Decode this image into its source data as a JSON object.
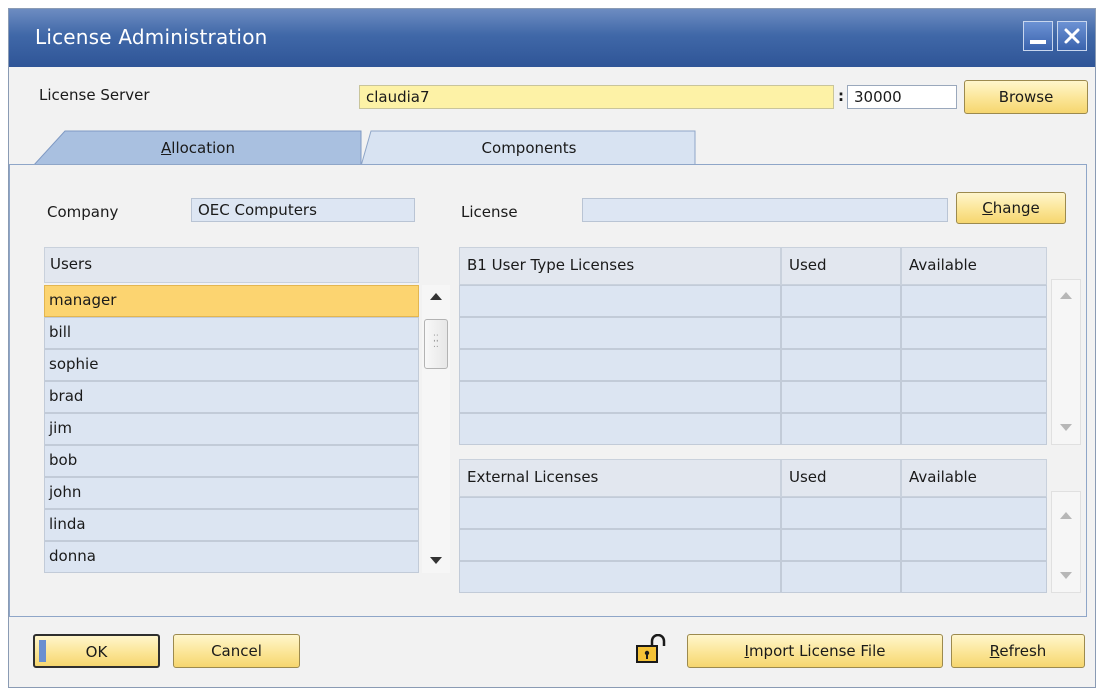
{
  "window": {
    "title": "License Administration"
  },
  "server": {
    "label": "License Server",
    "host": "claudia7",
    "separator": ":",
    "port": "30000",
    "browse_label": "Browse"
  },
  "tabs": [
    {
      "label": "Allocation",
      "active": true
    },
    {
      "label": "Components",
      "active": false
    }
  ],
  "allocation": {
    "company_label": "Company",
    "company_value": "OEC Computers",
    "license_label": "License",
    "license_value": "",
    "change_label": "Change",
    "users_header": "Users",
    "users": [
      "manager",
      "bill",
      "sophie",
      "brad",
      "jim",
      "bob",
      "john",
      "linda",
      "donna"
    ],
    "selected_user": "manager",
    "b1_grid": {
      "columns": [
        "B1 User Type Licenses",
        "Used",
        "Available"
      ]
    },
    "ext_grid": {
      "columns": [
        "External Licenses",
        "Used",
        "Available"
      ]
    }
  },
  "footer": {
    "ok_label": "OK",
    "cancel_label": "Cancel",
    "import_label": "Import License File",
    "refresh_label": "Refresh"
  },
  "icons": {
    "minimize": "minimize-icon",
    "close": "close-icon",
    "lock": "lock-open-icon"
  },
  "colors": {
    "title_bar": "#2f5597",
    "selection": "#fcd470",
    "button": "#fbe596",
    "field_yellow": "#fdf2a6"
  }
}
